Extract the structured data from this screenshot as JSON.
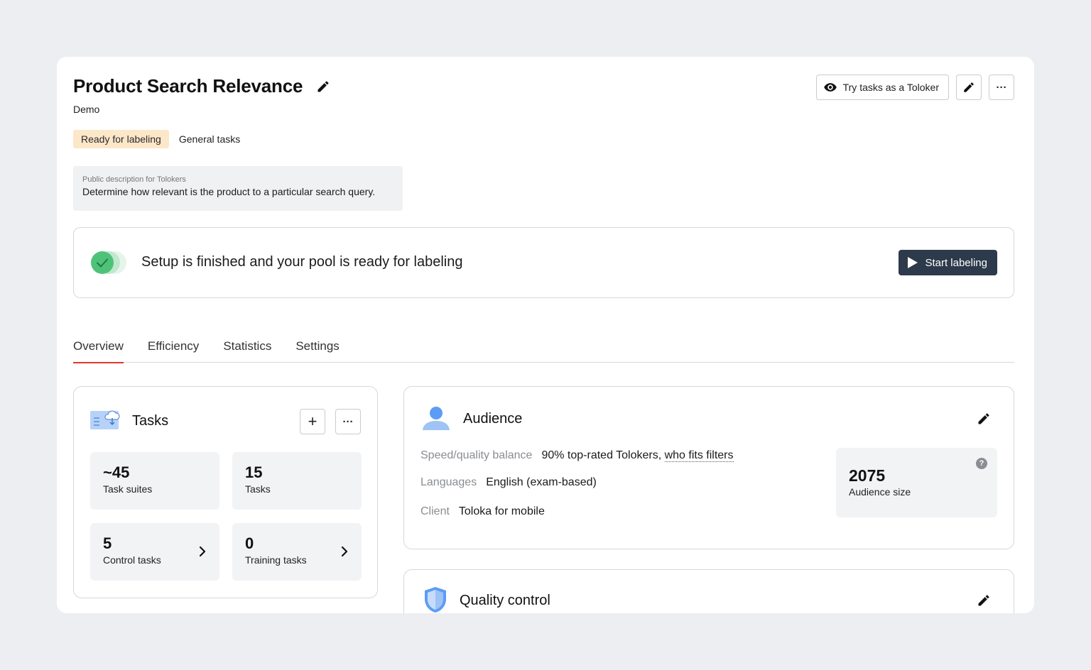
{
  "project": {
    "title": "Product Search Relevance",
    "subtitle": "Demo",
    "status_tag": "Ready for labeling",
    "category_tag": "General tasks",
    "description_label": "Public description for Tolokers",
    "description_text": "Determine how relevant is the product to a particular search query."
  },
  "top_actions": {
    "try_label": "Try tasks as a Toloker",
    "more_label": "···"
  },
  "setup": {
    "message": "Setup is finished and your pool is ready for labeling",
    "start_label": "Start labeling"
  },
  "tabs": [
    "Overview",
    "Efficiency",
    "Statistics",
    "Settings"
  ],
  "tasks": {
    "title": "Tasks",
    "add_label": "+",
    "more_label": "···",
    "tiles": [
      {
        "value": "~45",
        "label": "Task suites"
      },
      {
        "value": "15",
        "label": "Tasks"
      },
      {
        "value": "5",
        "label": "Control tasks"
      },
      {
        "value": "0",
        "label": "Training tasks"
      }
    ]
  },
  "audience": {
    "title": "Audience",
    "rows": [
      {
        "key": "Speed/quality balance",
        "value": "90% top-rated Tolokers,",
        "link": "who fits filters"
      },
      {
        "key": "Languages",
        "value": "English (exam-based)"
      },
      {
        "key": "Client",
        "value": "Toloka for mobile"
      }
    ],
    "size_value": "2075",
    "size_label": "Audience size",
    "help_label": "?"
  },
  "quality": {
    "title": "Quality control"
  },
  "colors": {
    "accent_red": "#e0362c",
    "status_tag_bg": "#fde7c9",
    "start_button_bg": "#2c3a4b",
    "success_green": "#4fc27a"
  }
}
